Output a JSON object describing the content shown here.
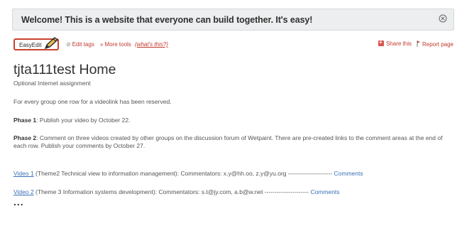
{
  "welcome": {
    "text": "Welcome! This is a website that everyone can build together. It's easy!"
  },
  "toolbar": {
    "easyedit_label": "EasyEdit",
    "edit_tags": "Edit tags",
    "more_tools": "More tools",
    "whats_this": "(what's this?)",
    "share_this": "Share this",
    "report_page": "Report page"
  },
  "page": {
    "title": "tjta111test Home",
    "subtitle": "Optional Internet assignment",
    "intro": "For every group one row for a videolink has been reserved.",
    "phase1_label": "Phase 1",
    "phase1_text": ": Publish your video by October 22.",
    "phase2_label": "Phase 2",
    "phase2_text": ": Comment on three videos created by other groups on the discussion forum of Wetpaint. There are pre-created links to the comment areas at the end of each row. Publish your comments by October 27."
  },
  "videos": [
    {
      "link": "Video 1",
      "text": " (Theme2 Technical view to information management): Commentators: x.y@hh.oo, z.y@yu.org ---------------------- ",
      "comments": "Comments"
    },
    {
      "link": "Video 2",
      "text": " (Theme 3 Information systems development):  Commentators: s.t@jy.com, a.b@w.net ---------------------- ",
      "comments": "Comments"
    }
  ],
  "ellipsis": "...",
  "colors": {
    "accent_red": "#c0392b",
    "link_blue": "#3a6fb5",
    "banner_bg": "#eceeef"
  },
  "icons": [
    "close-icon",
    "pencil-icon",
    "tag-icon",
    "share-icon",
    "report-icon"
  ]
}
